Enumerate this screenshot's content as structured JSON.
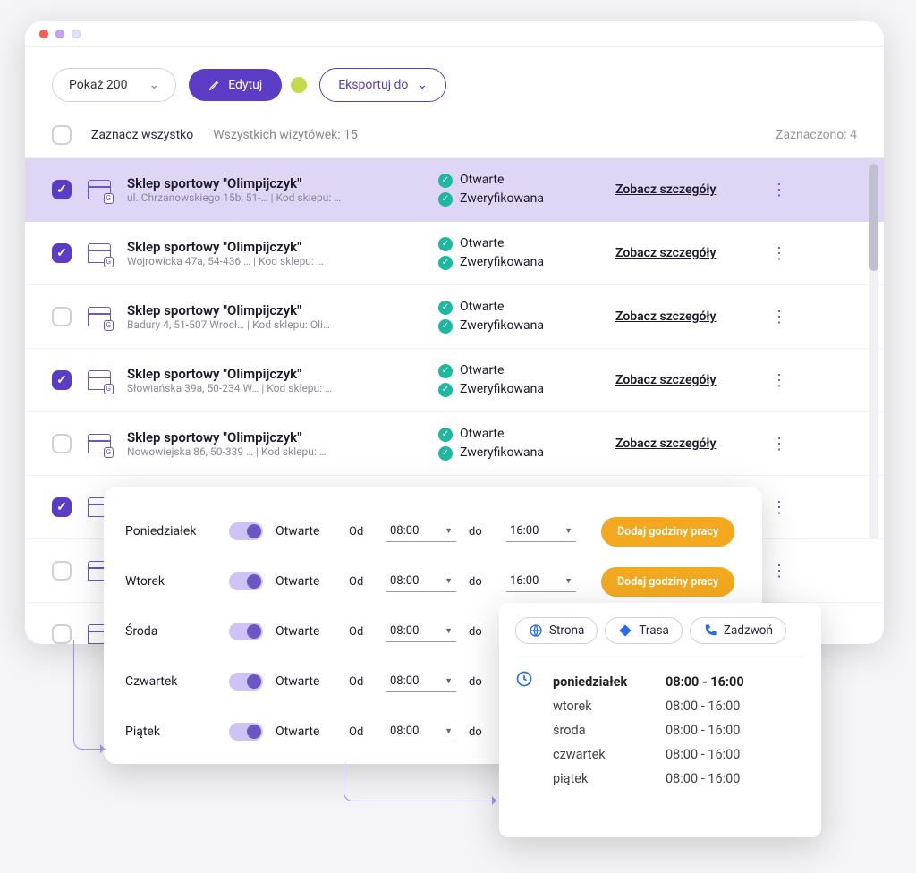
{
  "toolbar": {
    "show_label": "Pokaż 200",
    "edit_label": "Edytuj",
    "export_label": "Eksportuj do"
  },
  "subbar": {
    "select_all_label": "Zaznacz wszystko",
    "total_label": "Wszystkich wizytówek: 15",
    "selected_label": "Zaznaczono: 4"
  },
  "status_text": {
    "open": "Otwarte",
    "verified": "Zweryfikowana"
  },
  "details_label": "Zobacz szczegóły",
  "rows": [
    {
      "checked": true,
      "title": "Sklep sportowy \"Olimpijczyk\"",
      "sub": "ul. Chrzanowskiego 15b, 51-…   |   Kod sklepu: …"
    },
    {
      "checked": true,
      "title": "Sklep sportowy \"Olimpijczyk\"",
      "sub": "Wojrowicka 47a, 54-436 …   |   Kod sklepu: …"
    },
    {
      "checked": false,
      "title": "Sklep sportowy \"Olimpijczyk\"",
      "sub": "Badury 4, 51-507 Wrocł…   |   Kod sklepu: Oli…"
    },
    {
      "checked": true,
      "title": "Sklep sportowy \"Olimpijczyk\"",
      "sub": "Słowiańska 39a, 50-234 W…   |   Kod sklepu: …"
    },
    {
      "checked": false,
      "title": "Sklep sportowy \"Olimpijczyk\"",
      "sub": "Nowowiejska 86, 50-339 …   |   Kod sklepu: …"
    },
    {
      "checked": true,
      "title": "",
      "sub": ""
    },
    {
      "checked": false,
      "title": "",
      "sub": ""
    },
    {
      "checked": false,
      "title": "",
      "sub": ""
    }
  ],
  "hours": {
    "open_label": "Otwarte",
    "from_label": "Od",
    "to_label": "do",
    "add_label": "Dodaj godziny pracy",
    "days": [
      {
        "name": "Poniedziałek",
        "from": "08:00",
        "to": "16:00"
      },
      {
        "name": "Wtorek",
        "from": "08:00",
        "to": "16:00"
      },
      {
        "name": "Środa",
        "from": "08:00",
        "to": ""
      },
      {
        "name": "Czwartek",
        "from": "08:00",
        "to": ""
      },
      {
        "name": "Piątek",
        "from": "08:00",
        "to": ""
      }
    ]
  },
  "preview": {
    "actions": {
      "site": "Strona",
      "route": "Trasa",
      "call": "Zadzwoń"
    },
    "schedule": [
      {
        "day": "poniedziałek",
        "time": "08:00 - 16:00",
        "bold": true
      },
      {
        "day": "wtorek",
        "time": "08:00 - 16:00"
      },
      {
        "day": "środa",
        "time": "08:00 - 16:00"
      },
      {
        "day": "czwartek",
        "time": "08:00 - 16:00"
      },
      {
        "day": "piątek",
        "time": "08:00 - 16:00"
      }
    ]
  }
}
